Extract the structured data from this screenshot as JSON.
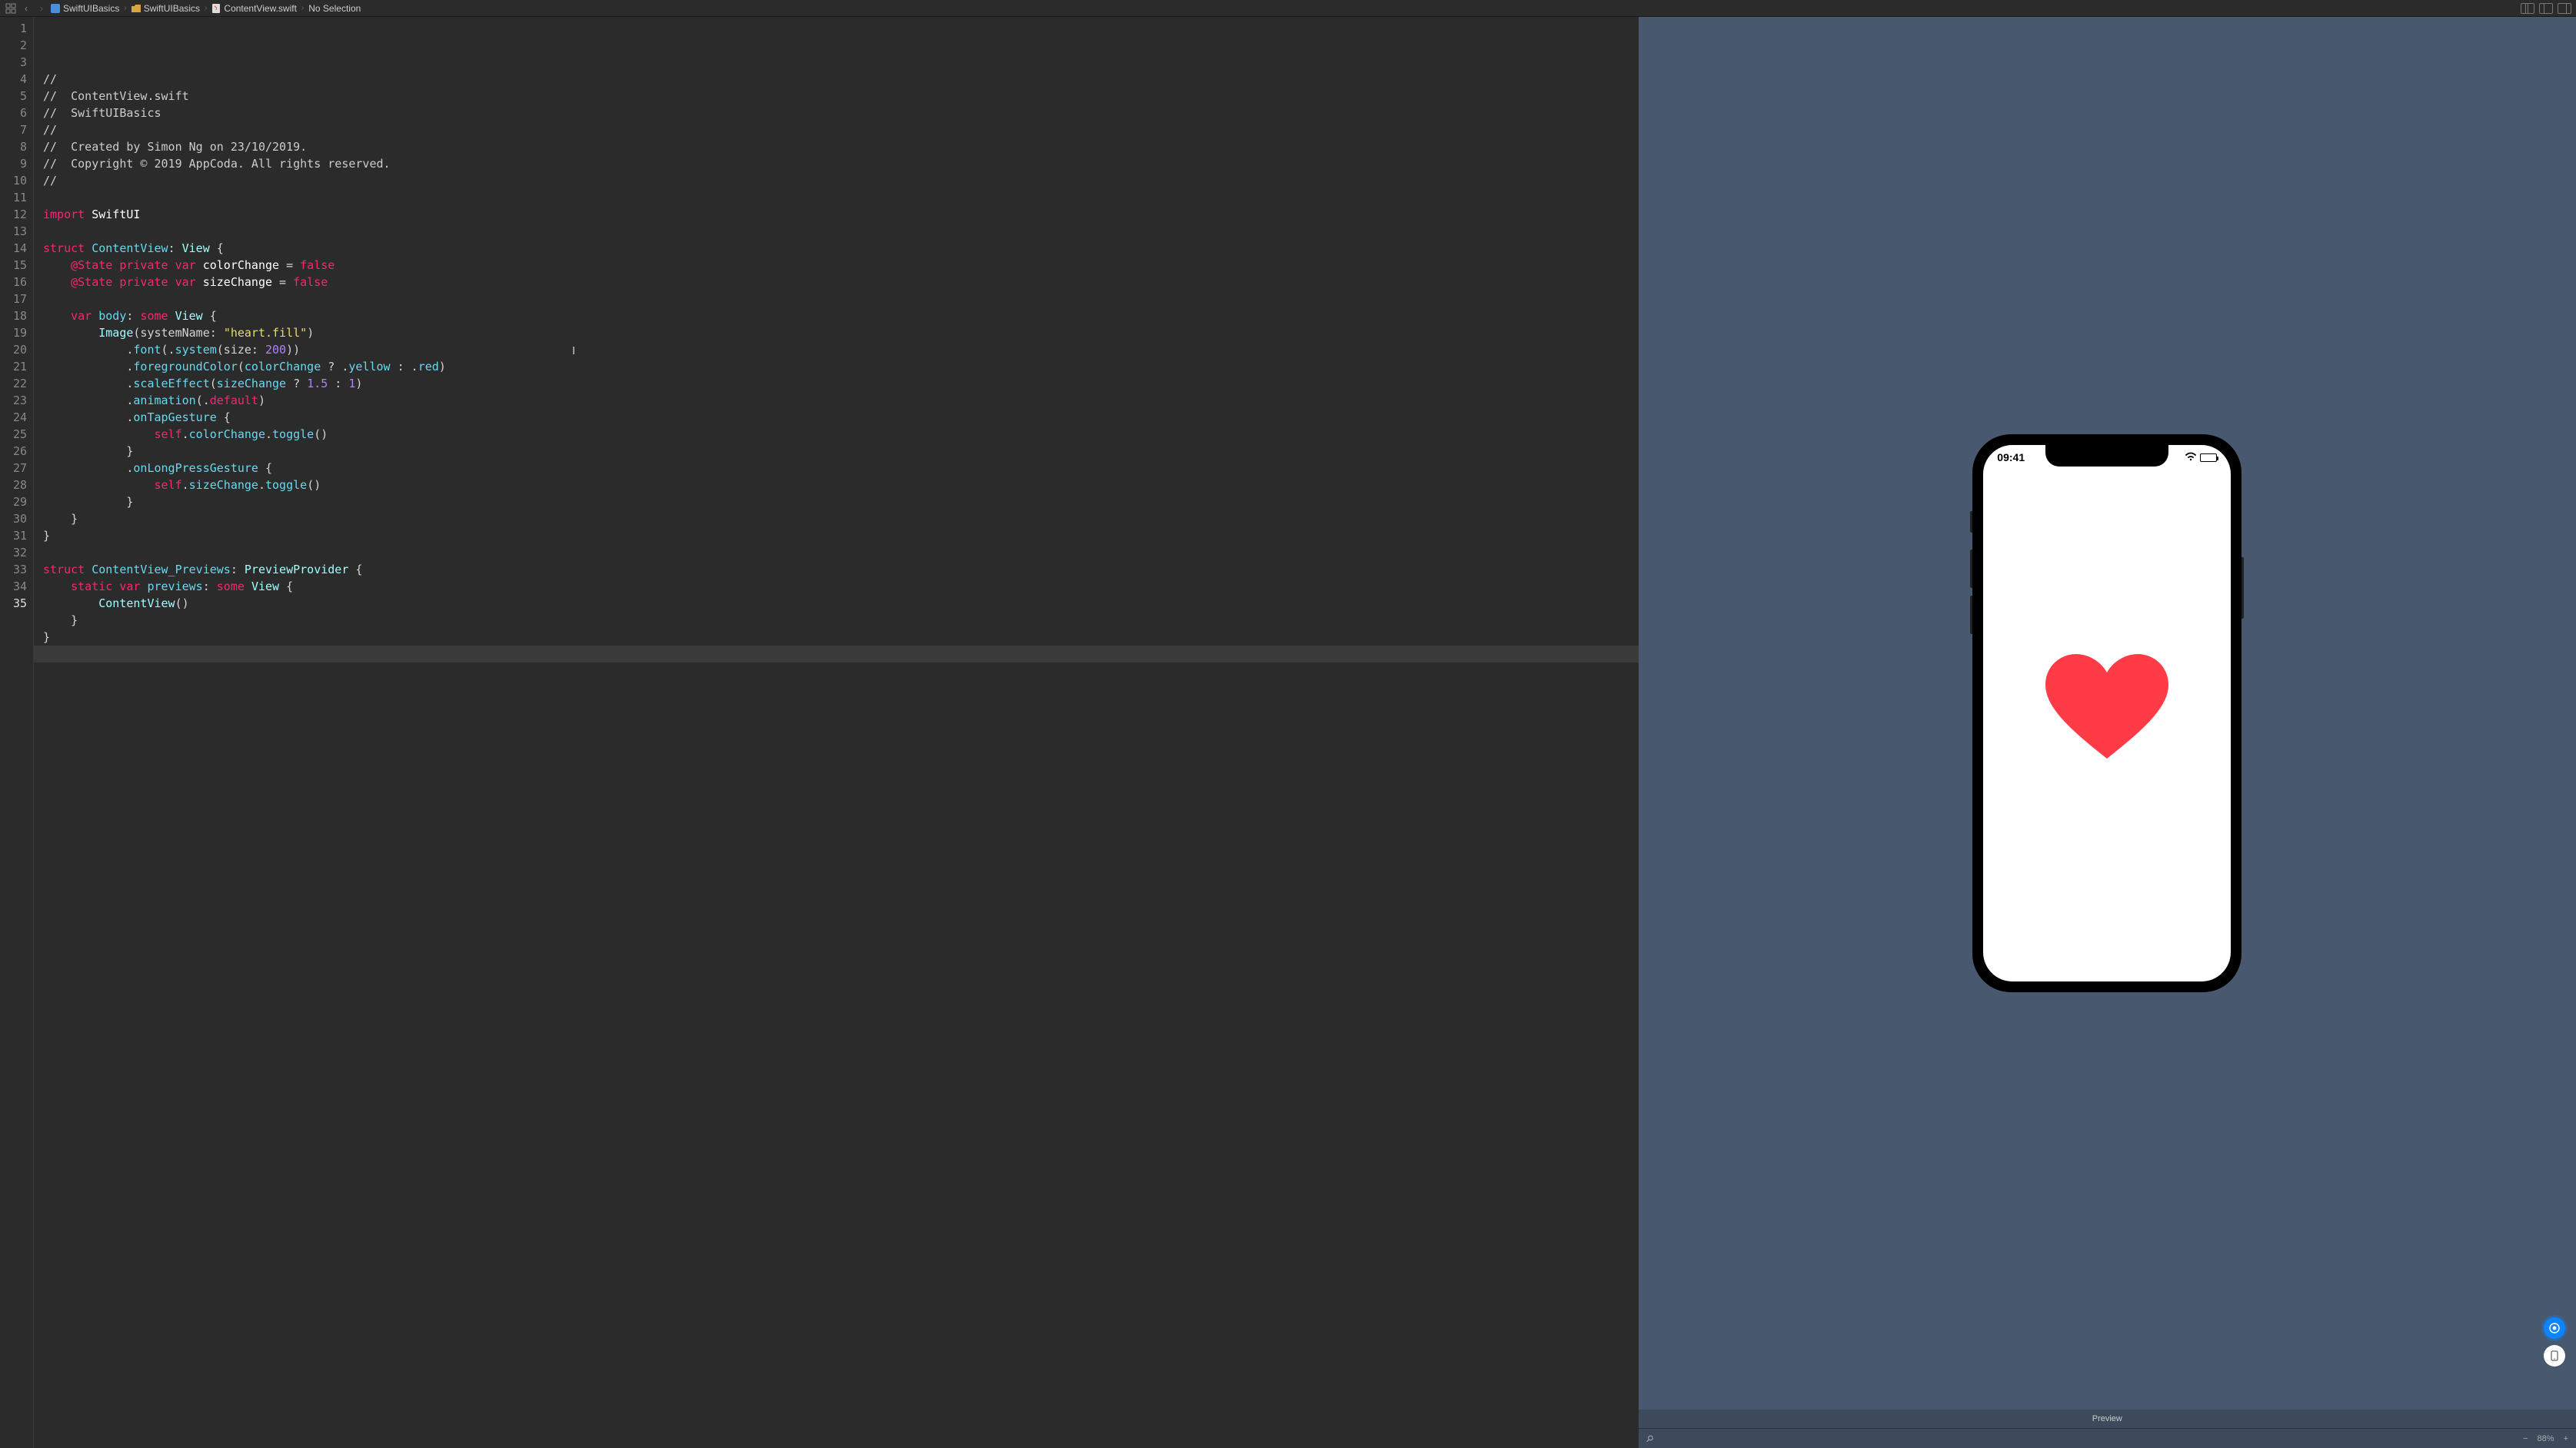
{
  "breadcrumb": {
    "items": [
      {
        "icon": "swift-file",
        "label": "SwiftUIBasics"
      },
      {
        "icon": "folder",
        "label": "SwiftUIBasics"
      },
      {
        "icon": "swift-file",
        "label": "ContentView.swift"
      },
      {
        "icon": "",
        "label": "No Selection"
      }
    ]
  },
  "code": {
    "lines": [
      {
        "n": 1,
        "seg": [
          {
            "c": "comment",
            "t": "//"
          }
        ]
      },
      {
        "n": 2,
        "seg": [
          {
            "c": "comment",
            "t": "//  ContentView.swift"
          }
        ]
      },
      {
        "n": 3,
        "seg": [
          {
            "c": "comment",
            "t": "//  SwiftUIBasics"
          }
        ]
      },
      {
        "n": 4,
        "seg": [
          {
            "c": "comment",
            "t": "//"
          }
        ]
      },
      {
        "n": 5,
        "seg": [
          {
            "c": "comment",
            "t": "//  Created by Simon Ng on 23/10/2019."
          }
        ]
      },
      {
        "n": 6,
        "seg": [
          {
            "c": "comment",
            "t": "//  Copyright © 2019 AppCoda. All rights reserved."
          }
        ]
      },
      {
        "n": 7,
        "seg": [
          {
            "c": "comment",
            "t": "//"
          }
        ]
      },
      {
        "n": 8,
        "seg": []
      },
      {
        "n": 9,
        "seg": [
          {
            "c": "kw",
            "t": "import"
          },
          {
            "c": "",
            "t": " "
          },
          {
            "c": "varname",
            "t": "SwiftUI"
          }
        ]
      },
      {
        "n": 10,
        "seg": []
      },
      {
        "n": 11,
        "seg": [
          {
            "c": "kw",
            "t": "struct"
          },
          {
            "c": "",
            "t": " "
          },
          {
            "c": "typeD",
            "t": "ContentView"
          },
          {
            "c": "",
            "t": ": "
          },
          {
            "c": "type",
            "t": "View"
          },
          {
            "c": "",
            "t": " {"
          }
        ]
      },
      {
        "n": 12,
        "seg": [
          {
            "c": "",
            "t": "    "
          },
          {
            "c": "kw",
            "t": "@State"
          },
          {
            "c": "",
            "t": " "
          },
          {
            "c": "kw",
            "t": "private"
          },
          {
            "c": "",
            "t": " "
          },
          {
            "c": "kw",
            "t": "var"
          },
          {
            "c": "",
            "t": " "
          },
          {
            "c": "varname",
            "t": "colorChange"
          },
          {
            "c": "",
            "t": " = "
          },
          {
            "c": "kw",
            "t": "false"
          }
        ]
      },
      {
        "n": 13,
        "seg": [
          {
            "c": "",
            "t": "    "
          },
          {
            "c": "kw",
            "t": "@State"
          },
          {
            "c": "",
            "t": " "
          },
          {
            "c": "kw",
            "t": "private"
          },
          {
            "c": "",
            "t": " "
          },
          {
            "c": "kw",
            "t": "var"
          },
          {
            "c": "",
            "t": " "
          },
          {
            "c": "varname",
            "t": "sizeChange"
          },
          {
            "c": "",
            "t": " = "
          },
          {
            "c": "kw",
            "t": "false"
          }
        ]
      },
      {
        "n": 14,
        "seg": []
      },
      {
        "n": 15,
        "seg": [
          {
            "c": "",
            "t": "    "
          },
          {
            "c": "kw",
            "t": "var"
          },
          {
            "c": "",
            "t": " "
          },
          {
            "c": "prop",
            "t": "body"
          },
          {
            "c": "",
            "t": ": "
          },
          {
            "c": "kw",
            "t": "some"
          },
          {
            "c": "",
            "t": " "
          },
          {
            "c": "type",
            "t": "View"
          },
          {
            "c": "",
            "t": " {"
          }
        ]
      },
      {
        "n": 16,
        "seg": [
          {
            "c": "",
            "t": "        "
          },
          {
            "c": "type",
            "t": "Image"
          },
          {
            "c": "",
            "t": "(systemName: "
          },
          {
            "c": "str",
            "t": "\"heart.fill\""
          },
          {
            "c": "",
            "t": ")"
          }
        ]
      },
      {
        "n": 17,
        "seg": [
          {
            "c": "",
            "t": "            ."
          },
          {
            "c": "fn",
            "t": "font"
          },
          {
            "c": "",
            "t": "(."
          },
          {
            "c": "fn",
            "t": "system"
          },
          {
            "c": "",
            "t": "(size: "
          },
          {
            "c": "num",
            "t": "200"
          },
          {
            "c": "",
            "t": "))"
          }
        ]
      },
      {
        "n": 18,
        "seg": [
          {
            "c": "",
            "t": "            ."
          },
          {
            "c": "fn",
            "t": "foregroundColor"
          },
          {
            "c": "",
            "t": "("
          },
          {
            "c": "prop",
            "t": "colorChange"
          },
          {
            "c": "",
            "t": " ? ."
          },
          {
            "c": "prop",
            "t": "yellow"
          },
          {
            "c": "",
            "t": " : ."
          },
          {
            "c": "prop",
            "t": "red"
          },
          {
            "c": "",
            "t": ")"
          }
        ]
      },
      {
        "n": 19,
        "seg": [
          {
            "c": "",
            "t": "            ."
          },
          {
            "c": "fn",
            "t": "scaleEffect"
          },
          {
            "c": "",
            "t": "("
          },
          {
            "c": "prop",
            "t": "sizeChange"
          },
          {
            "c": "",
            "t": " ? "
          },
          {
            "c": "num",
            "t": "1.5"
          },
          {
            "c": "",
            "t": " : "
          },
          {
            "c": "num",
            "t": "1"
          },
          {
            "c": "",
            "t": ")"
          }
        ]
      },
      {
        "n": 20,
        "seg": [
          {
            "c": "",
            "t": "            ."
          },
          {
            "c": "fn",
            "t": "animation"
          },
          {
            "c": "",
            "t": "(."
          },
          {
            "c": "kw",
            "t": "default"
          },
          {
            "c": "",
            "t": ")"
          }
        ]
      },
      {
        "n": 21,
        "seg": [
          {
            "c": "",
            "t": "            ."
          },
          {
            "c": "fn",
            "t": "onTapGesture"
          },
          {
            "c": "",
            "t": " {"
          }
        ]
      },
      {
        "n": 22,
        "seg": [
          {
            "c": "",
            "t": "                "
          },
          {
            "c": "kw",
            "t": "self"
          },
          {
            "c": "",
            "t": "."
          },
          {
            "c": "prop",
            "t": "colorChange"
          },
          {
            "c": "",
            "t": "."
          },
          {
            "c": "fn",
            "t": "toggle"
          },
          {
            "c": "",
            "t": "()"
          }
        ]
      },
      {
        "n": 23,
        "seg": [
          {
            "c": "",
            "t": "            }"
          }
        ]
      },
      {
        "n": 24,
        "seg": [
          {
            "c": "",
            "t": "            ."
          },
          {
            "c": "fn",
            "t": "onLongPressGesture"
          },
          {
            "c": "",
            "t": " {"
          }
        ]
      },
      {
        "n": 25,
        "seg": [
          {
            "c": "",
            "t": "                "
          },
          {
            "c": "kw",
            "t": "self"
          },
          {
            "c": "",
            "t": "."
          },
          {
            "c": "prop",
            "t": "sizeChange"
          },
          {
            "c": "",
            "t": "."
          },
          {
            "c": "fn",
            "t": "toggle"
          },
          {
            "c": "",
            "t": "()"
          }
        ]
      },
      {
        "n": 26,
        "seg": [
          {
            "c": "",
            "t": "            }"
          }
        ]
      },
      {
        "n": 27,
        "seg": [
          {
            "c": "",
            "t": "    }"
          }
        ]
      },
      {
        "n": 28,
        "seg": [
          {
            "c": "",
            "t": "}"
          }
        ]
      },
      {
        "n": 29,
        "seg": []
      },
      {
        "n": 30,
        "seg": [
          {
            "c": "kw",
            "t": "struct"
          },
          {
            "c": "",
            "t": " "
          },
          {
            "c": "typeD",
            "t": "ContentView_Previews"
          },
          {
            "c": "",
            "t": ": "
          },
          {
            "c": "type",
            "t": "PreviewProvider"
          },
          {
            "c": "",
            "t": " {"
          }
        ]
      },
      {
        "n": 31,
        "seg": [
          {
            "c": "",
            "t": "    "
          },
          {
            "c": "kw",
            "t": "static"
          },
          {
            "c": "",
            "t": " "
          },
          {
            "c": "kw",
            "t": "var"
          },
          {
            "c": "",
            "t": " "
          },
          {
            "c": "prop",
            "t": "previews"
          },
          {
            "c": "",
            "t": ": "
          },
          {
            "c": "kw",
            "t": "some"
          },
          {
            "c": "",
            "t": " "
          },
          {
            "c": "type",
            "t": "View"
          },
          {
            "c": "",
            "t": " {"
          }
        ]
      },
      {
        "n": 32,
        "seg": [
          {
            "c": "",
            "t": "        "
          },
          {
            "c": "type",
            "t": "ContentView"
          },
          {
            "c": "",
            "t": "()"
          }
        ]
      },
      {
        "n": 33,
        "seg": [
          {
            "c": "",
            "t": "    }"
          }
        ]
      },
      {
        "n": 34,
        "seg": [
          {
            "c": "",
            "t": "}"
          }
        ]
      },
      {
        "n": 35,
        "seg": [],
        "active": true
      }
    ]
  },
  "preview": {
    "label": "Preview",
    "time": "09:41",
    "zoom": "88%",
    "heartColor": "#FF3B47"
  }
}
